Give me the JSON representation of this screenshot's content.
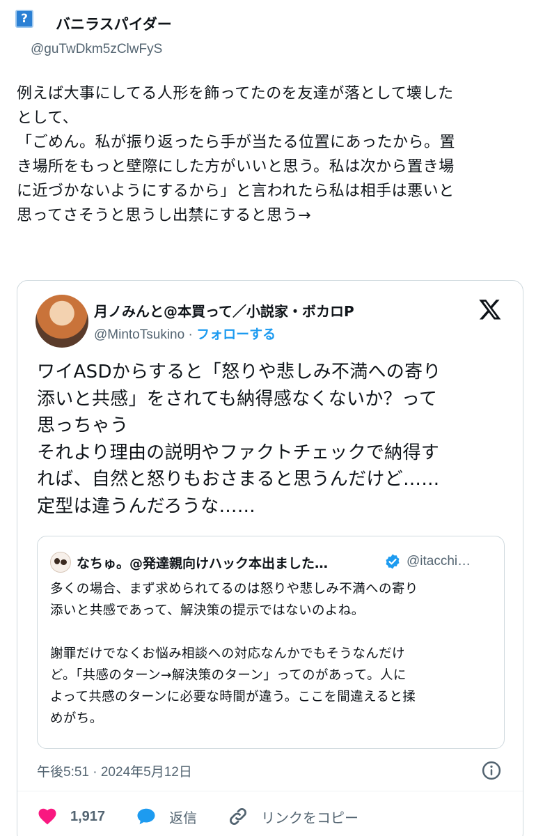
{
  "tweet": {
    "author_name": "バニラスパイダー",
    "author_handle": "@guTwDkm5zClwFyS",
    "text": "例えば大事にしてる人形を飾ってたのを友達が落として壊した\nとして、\n「ごめん。私が振り返ったら手が当たる位置にあったから。置\nき場所をもっと壁際にした方がいいと思う。私は次から置き場\nに近づかないようにするから」と言われたら私は相手は悪いと\n思ってさそうと思うし出禁にすると思う→"
  },
  "embedded": {
    "author_name": "月ノみんと@本買って／小説家・ボカロP",
    "author_handle": "@MintoTsukino",
    "separator": " · ",
    "follow_label": "フォローする",
    "text": "ワイASDからすると「怒りや悲しみ不満への寄り\n添いと共感」をされても納得感なくないか？って\n思っちゃう\nそれより理由の説明やファクトチェックで納得す\nれば、自然と怒りもおさまると思うんだけど……\n定型は違うんだろうな……",
    "quoted": {
      "author_name": "なちゅ。@発達親向けハック本出ました…",
      "author_handle": "@itacchi…",
      "text": "多くの場合、まず求められてるのは怒りや悲しみ不満への寄り\n添いと共感であって、解決策の提示ではないのよね。\n\n謝罪だけでなくお悩み相談への対応なんかでもそうなんだけ\nど。「共感のターン→解決策のターン」ってのがあって。人に\nよって共感のターンに必要な時間が違う。ここを間違えると揉\nめがち。"
    },
    "timestamp": "午後5:51 · 2024年5月12日",
    "actions": {
      "like_count": "1,917",
      "reply_label": "返信",
      "copy_link_label": "リンクをコピー"
    }
  },
  "colors": {
    "accent": "#1d9bf0",
    "like": "#f91880",
    "muted": "#536471"
  }
}
